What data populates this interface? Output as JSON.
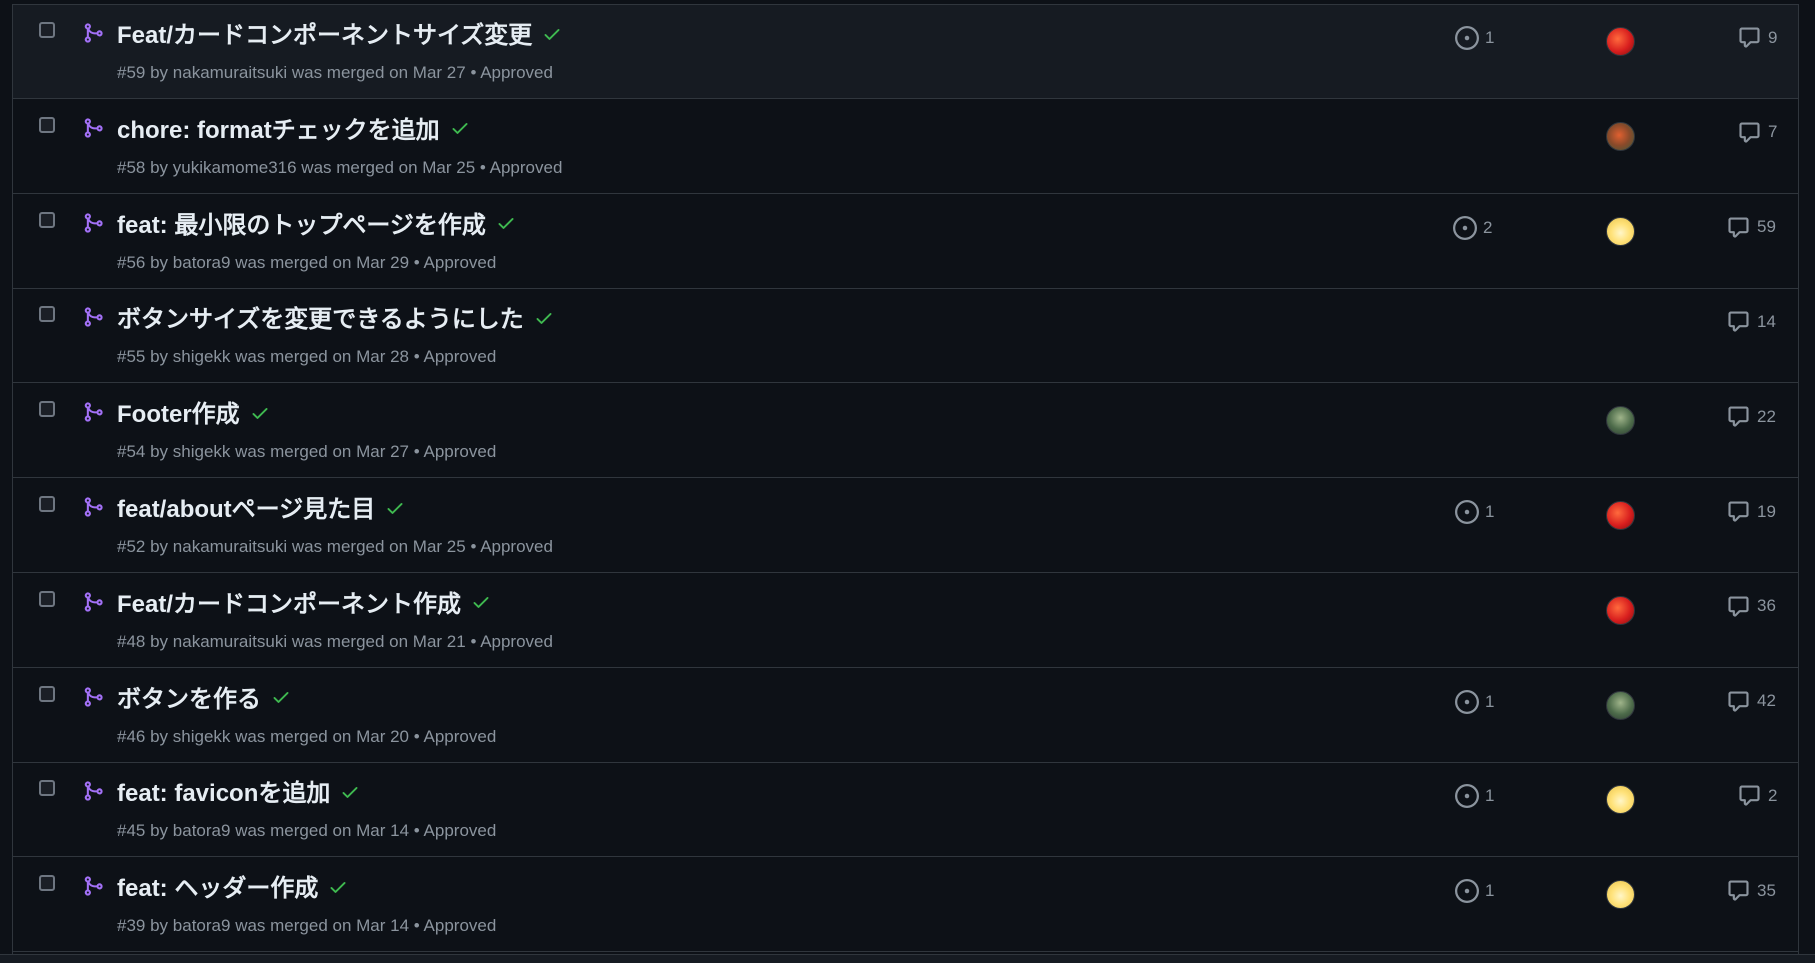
{
  "pull_requests": [
    {
      "title": "Feat/カードコンポーネントサイズ変更",
      "number": "#59",
      "author": "nakamuraitsuki",
      "merged_text": "was merged on Mar 27",
      "review": "Approved",
      "linked_issues": "1",
      "avatar": "red",
      "comments": "9"
    },
    {
      "title": "chore: formatチェックを追加",
      "number": "#58",
      "author": "yukikamome316",
      "merged_text": "was merged on Mar 25",
      "review": "Approved",
      "linked_issues": "",
      "avatar": "mixed",
      "comments": "7"
    },
    {
      "title": "feat: 最小限のトップページを作成",
      "number": "#56",
      "author": "batora9",
      "merged_text": "was merged on Mar 29",
      "review": "Approved",
      "linked_issues": "2",
      "avatar": "yellow",
      "comments": "59"
    },
    {
      "title": "ボタンサイズを変更できるようにした",
      "number": "#55",
      "author": "shigekk",
      "merged_text": "was merged on Mar 28",
      "review": "Approved",
      "linked_issues": "",
      "avatar": "",
      "comments": "14"
    },
    {
      "title": "Footer作成",
      "number": "#54",
      "author": "shigekk",
      "merged_text": "was merged on Mar 27",
      "review": "Approved",
      "linked_issues": "",
      "avatar": "green",
      "comments": "22"
    },
    {
      "title": "feat/aboutページ見た目",
      "number": "#52",
      "author": "nakamuraitsuki",
      "merged_text": "was merged on Mar 25",
      "review": "Approved",
      "linked_issues": "1",
      "avatar": "red",
      "comments": "19"
    },
    {
      "title": "Feat/カードコンポーネント作成",
      "number": "#48",
      "author": "nakamuraitsuki",
      "merged_text": "was merged on Mar 21",
      "review": "Approved",
      "linked_issues": "",
      "avatar": "red",
      "comments": "36"
    },
    {
      "title": "ボタンを作る",
      "number": "#46",
      "author": "shigekk",
      "merged_text": "was merged on Mar 20",
      "review": "Approved",
      "linked_issues": "1",
      "avatar": "green",
      "comments": "42"
    },
    {
      "title": "feat: faviconを追加",
      "number": "#45",
      "author": "batora9",
      "merged_text": "was merged on Mar 14",
      "review": "Approved",
      "linked_issues": "1",
      "avatar": "yellow",
      "comments": "2"
    },
    {
      "title": "feat: ヘッダー作成",
      "number": "#39",
      "author": "batora9",
      "merged_text": "was merged on Mar 14",
      "review": "Approved",
      "linked_issues": "1",
      "avatar": "yellow",
      "comments": "35"
    }
  ],
  "icons": {
    "pr_state": "git-merge-icon",
    "review_ok": "check-icon",
    "linked": "issue-opened-icon",
    "comments": "comment-icon"
  },
  "colors": {
    "merged": "#a371f7",
    "approved_check": "#3fb950",
    "background": "#0d1117",
    "border": "#30363d"
  }
}
